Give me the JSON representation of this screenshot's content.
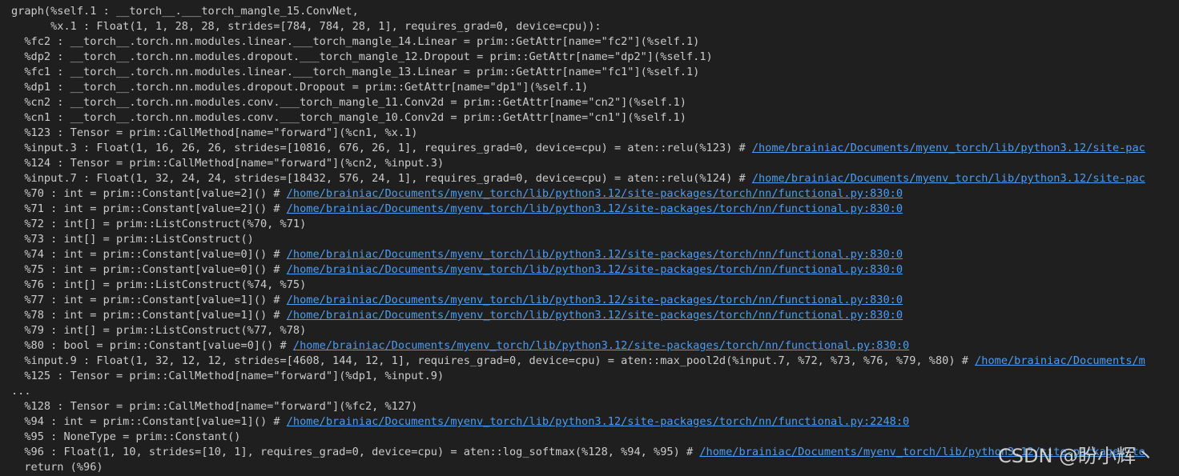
{
  "terminal": {
    "background": "#1f1f1f",
    "text_color": "#cccccc",
    "link_color": "#4c9df3",
    "lines": [
      {
        "text": "graph(%self.1 : __torch__.___torch_mangle_15.ConvNet,",
        "link": ""
      },
      {
        "text": "      %x.1 : Float(1, 1, 28, 28, strides=[784, 784, 28, 1], requires_grad=0, device=cpu)):",
        "link": ""
      },
      {
        "text": "  %fc2 : __torch__.torch.nn.modules.linear.___torch_mangle_14.Linear = prim::GetAttr[name=\"fc2\"](%self.1)",
        "link": ""
      },
      {
        "text": "  %dp2 : __torch__.torch.nn.modules.dropout.___torch_mangle_12.Dropout = prim::GetAttr[name=\"dp2\"](%self.1)",
        "link": ""
      },
      {
        "text": "  %fc1 : __torch__.torch.nn.modules.linear.___torch_mangle_13.Linear = prim::GetAttr[name=\"fc1\"](%self.1)",
        "link": ""
      },
      {
        "text": "  %dp1 : __torch__.torch.nn.modules.dropout.Dropout = prim::GetAttr[name=\"dp1\"](%self.1)",
        "link": ""
      },
      {
        "text": "  %cn2 : __torch__.torch.nn.modules.conv.___torch_mangle_11.Conv2d = prim::GetAttr[name=\"cn2\"](%self.1)",
        "link": ""
      },
      {
        "text": "  %cn1 : __torch__.torch.nn.modules.conv.___torch_mangle_10.Conv2d = prim::GetAttr[name=\"cn1\"](%self.1)",
        "link": ""
      },
      {
        "text": "  %123 : Tensor = prim::CallMethod[name=\"forward\"](%cn1, %x.1)",
        "link": ""
      },
      {
        "text": "  %input.3 : Float(1, 16, 26, 26, strides=[10816, 676, 26, 1], requires_grad=0, device=cpu) = aten::relu(%123) # ",
        "link": "/home/brainiac/Documents/myenv_torch/lib/python3.12/site-pac"
      },
      {
        "text": "  %124 : Tensor = prim::CallMethod[name=\"forward\"](%cn2, %input.3)",
        "link": ""
      },
      {
        "text": "  %input.7 : Float(1, 32, 24, 24, strides=[18432, 576, 24, 1], requires_grad=0, device=cpu) = aten::relu(%124) # ",
        "link": "/home/brainiac/Documents/myenv_torch/lib/python3.12/site-pac"
      },
      {
        "text": "  %70 : int = prim::Constant[value=2]() # ",
        "link": "/home/brainiac/Documents/myenv_torch/lib/python3.12/site-packages/torch/nn/functional.py:830:0"
      },
      {
        "text": "  %71 : int = prim::Constant[value=2]() # ",
        "link": "/home/brainiac/Documents/myenv_torch/lib/python3.12/site-packages/torch/nn/functional.py:830:0"
      },
      {
        "text": "  %72 : int[] = prim::ListConstruct(%70, %71)",
        "link": ""
      },
      {
        "text": "  %73 : int[] = prim::ListConstruct()",
        "link": ""
      },
      {
        "text": "  %74 : int = prim::Constant[value=0]() # ",
        "link": "/home/brainiac/Documents/myenv_torch/lib/python3.12/site-packages/torch/nn/functional.py:830:0"
      },
      {
        "text": "  %75 : int = prim::Constant[value=0]() # ",
        "link": "/home/brainiac/Documents/myenv_torch/lib/python3.12/site-packages/torch/nn/functional.py:830:0"
      },
      {
        "text": "  %76 : int[] = prim::ListConstruct(%74, %75)",
        "link": ""
      },
      {
        "text": "  %77 : int = prim::Constant[value=1]() # ",
        "link": "/home/brainiac/Documents/myenv_torch/lib/python3.12/site-packages/torch/nn/functional.py:830:0"
      },
      {
        "text": "  %78 : int = prim::Constant[value=1]() # ",
        "link": "/home/brainiac/Documents/myenv_torch/lib/python3.12/site-packages/torch/nn/functional.py:830:0"
      },
      {
        "text": "  %79 : int[] = prim::ListConstruct(%77, %78)",
        "link": ""
      },
      {
        "text": "  %80 : bool = prim::Constant[value=0]() # ",
        "link": "/home/brainiac/Documents/myenv_torch/lib/python3.12/site-packages/torch/nn/functional.py:830:0"
      },
      {
        "text": "  %input.9 : Float(1, 32, 12, 12, strides=[4608, 144, 12, 1], requires_grad=0, device=cpu) = aten::max_pool2d(%input.7, %72, %73, %76, %79, %80) # ",
        "link": "/home/brainiac/Documents/m"
      },
      {
        "text": "  %125 : Tensor = prim::CallMethod[name=\"forward\"](%dp1, %input.9)",
        "link": ""
      },
      {
        "text": "...",
        "link": ""
      },
      {
        "text": "  %128 : Tensor = prim::CallMethod[name=\"forward\"](%fc2, %127)",
        "link": ""
      },
      {
        "text": "  %94 : int = prim::Constant[value=1]() # ",
        "link": "/home/brainiac/Documents/myenv_torch/lib/python3.12/site-packages/torch/nn/functional.py:2248:0"
      },
      {
        "text": "  %95 : NoneType = prim::Constant()",
        "link": ""
      },
      {
        "text": "  %96 : Float(1, 10, strides=[10, 1], requires_grad=0, device=cpu) = aten::log_softmax(%128, %94, %95) # ",
        "link": "/home/brainiac/Documents/myenv_torch/lib/python3.12/site-packages/to"
      },
      {
        "text": "  return (%96)",
        "link": ""
      }
    ]
  },
  "watermark": {
    "text": "CSDN @盼小辉丶"
  }
}
